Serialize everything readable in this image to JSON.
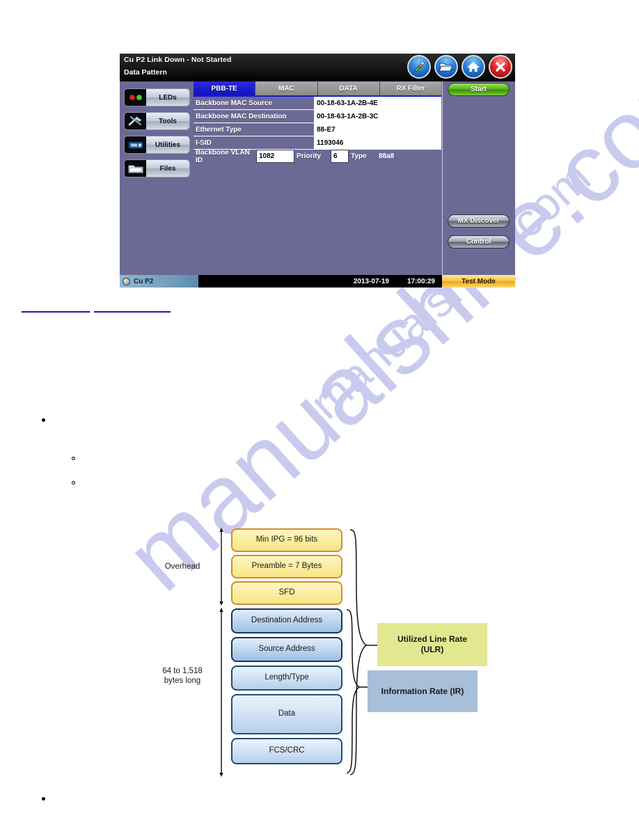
{
  "watermark": {
    "line_a": "manualshive.com",
    "line_b": "manualshive.com"
  },
  "device": {
    "titlebar": {
      "line1": "Cu P2 Link Down  - Not Started",
      "line2": "Data Pattern",
      "icons": [
        {
          "name": "tools-brush-icon",
          "glyph": "✒"
        },
        {
          "name": "open-folder-icon",
          "glyph": "▰"
        },
        {
          "name": "home-icon",
          "glyph": "⌂"
        },
        {
          "name": "close-icon",
          "glyph": "✕"
        }
      ]
    },
    "sidebar": {
      "items": [
        {
          "label": "LEDs",
          "icon": "leds-icon"
        },
        {
          "label": "Tools",
          "icon": "tools-icon"
        },
        {
          "label": "Utilities",
          "icon": "utilities-icon"
        },
        {
          "label": "Files",
          "icon": "files-folder-icon"
        }
      ]
    },
    "tabs": [
      {
        "label": "PBB-TE",
        "active": true
      },
      {
        "label": "MAC",
        "active": false
      },
      {
        "label": "DATA",
        "active": false
      },
      {
        "label": "RX Filter",
        "active": false
      }
    ],
    "form": {
      "rows": [
        {
          "label": "Backbone MAC Source",
          "value": "00-18-63-1A-2B-4E"
        },
        {
          "label": "Backbone MAC Destination",
          "value": "00-18-63-1A-2B-3C"
        },
        {
          "label": "Ethernet Type",
          "value": "88-E7"
        },
        {
          "label": "I-SID",
          "value": "1193046"
        }
      ],
      "vlan_row": {
        "vlan_label": "Backbone VLAN ID",
        "vlan_value": "1082",
        "priority_label": "Priority",
        "priority_value": "6",
        "type_label": "Type",
        "type_value": "88a8"
      }
    },
    "right_buttons": [
      {
        "label": "Start",
        "style": "green"
      },
      {
        "label": "MX Discover",
        "style": "grey"
      },
      {
        "label": "Control",
        "style": "grey"
      }
    ],
    "statusbar": {
      "port": "Cu P2",
      "date": "2013-07-19",
      "time": "17:00:29",
      "mode": "Test Mode"
    },
    "colors": {
      "panel_bg": "#6b6a95",
      "tab_active": "#1c1cc8",
      "start_green": "#5fb61f",
      "test_mode_amber": "#f7c846",
      "close_red": "#e02020"
    }
  },
  "diagram": {
    "overhead_label": "Overhead",
    "length_label": "64 to 1,518\nbytes long",
    "length_label_line1": "64 to 1,518",
    "length_label_line2": "bytes long",
    "boxes": [
      {
        "label": "Min IPG = 96 bits",
        "group": "overhead"
      },
      {
        "label": "Preamble = 7 Bytes",
        "group": "overhead"
      },
      {
        "label": "SFD",
        "group": "overhead"
      },
      {
        "label": "Destination Address",
        "group": "frame"
      },
      {
        "label": "Source Address",
        "group": "frame"
      },
      {
        "label": "Length/Type",
        "group": "frame"
      },
      {
        "label": "Data",
        "group": "frame"
      },
      {
        "label": "FCS/CRC",
        "group": "frame"
      }
    ],
    "rates": [
      {
        "line1": "Utilized Line Rate",
        "line2": "(ULR)",
        "color": "#e2e88f"
      },
      {
        "line1": "Information Rate (IR)",
        "line2": "",
        "color": "#a8bfd9"
      }
    ]
  }
}
